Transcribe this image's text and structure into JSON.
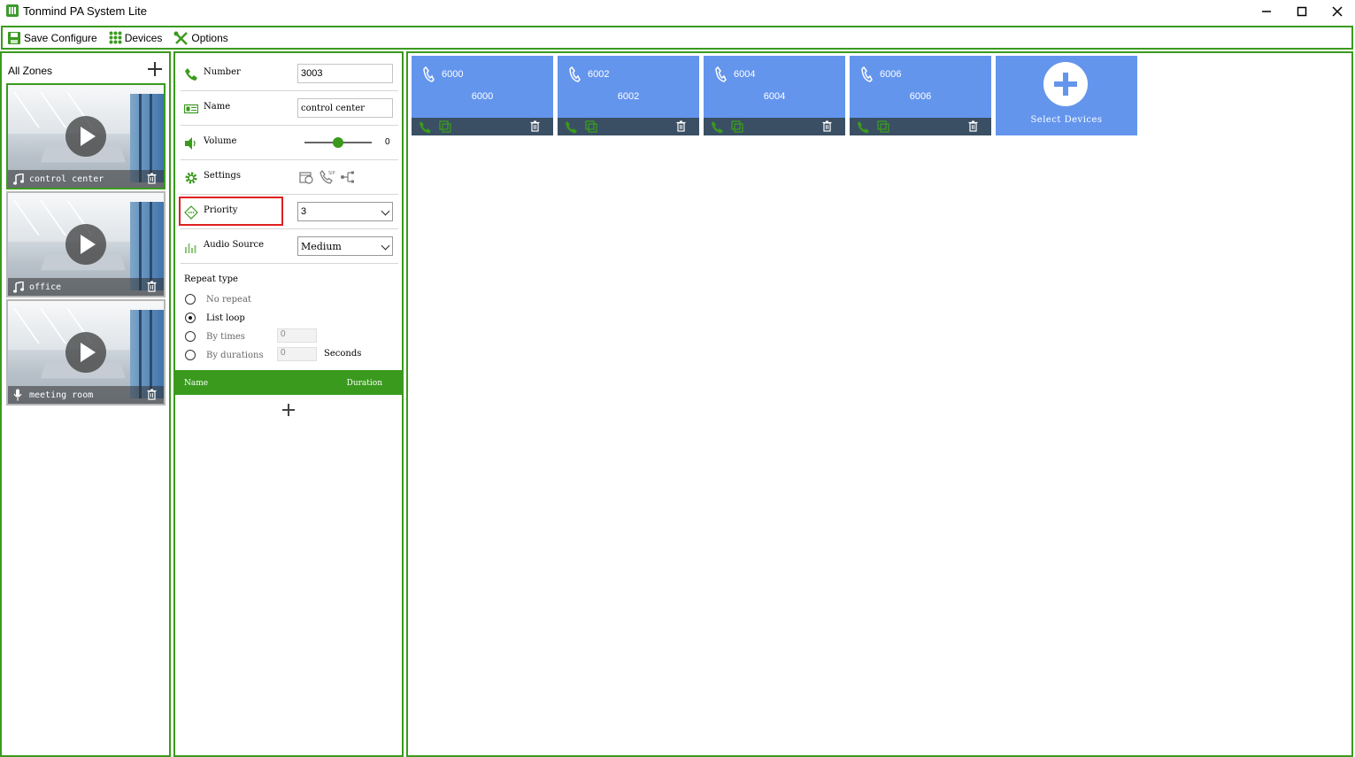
{
  "window": {
    "title": "Tonmind PA System Lite"
  },
  "toolbar": {
    "save_label": "Save Configure",
    "devices_label": "Devices",
    "options_label": "Options"
  },
  "zones": {
    "header": "All Zones",
    "items": [
      {
        "label": "control center",
        "icon": "music-note-icon",
        "selected": true
      },
      {
        "label": "office",
        "icon": "music-note-icon",
        "selected": false
      },
      {
        "label": "meeting room",
        "icon": "microphone-icon",
        "selected": false
      }
    ]
  },
  "config": {
    "number_label": "Number",
    "number_value": "3003",
    "name_label": "Name",
    "name_value": "control center",
    "volume_label": "Volume",
    "volume_value": "0",
    "volume_level": 0.5,
    "settings_label": "Settings",
    "priority_label": "Priority",
    "priority_value": "3",
    "audio_source_label": "Audio Source",
    "audio_source_value": "Medium",
    "repeat_type_label": "Repeat type",
    "repeat_options": [
      {
        "label": "No repeat",
        "selected": false
      },
      {
        "label": "List loop",
        "selected": true
      },
      {
        "label": "By times",
        "selected": false,
        "value": "0"
      },
      {
        "label": "By durations",
        "selected": false,
        "value": "0",
        "unit": "Seconds"
      }
    ],
    "list_col_name": "Name",
    "list_col_duration": "Duration"
  },
  "devices": {
    "cards": [
      {
        "number": "6000",
        "name": "6000"
      },
      {
        "number": "6002",
        "name": "6002"
      },
      {
        "number": "6004",
        "name": "6004"
      },
      {
        "number": "6006",
        "name": "6006"
      }
    ],
    "add_label": "Select Devices"
  },
  "colors": {
    "accent_green": "#3a9a1e",
    "card_blue": "#6495ed",
    "card_bar": "#3a4f63",
    "highlight_red": "#e02020"
  }
}
